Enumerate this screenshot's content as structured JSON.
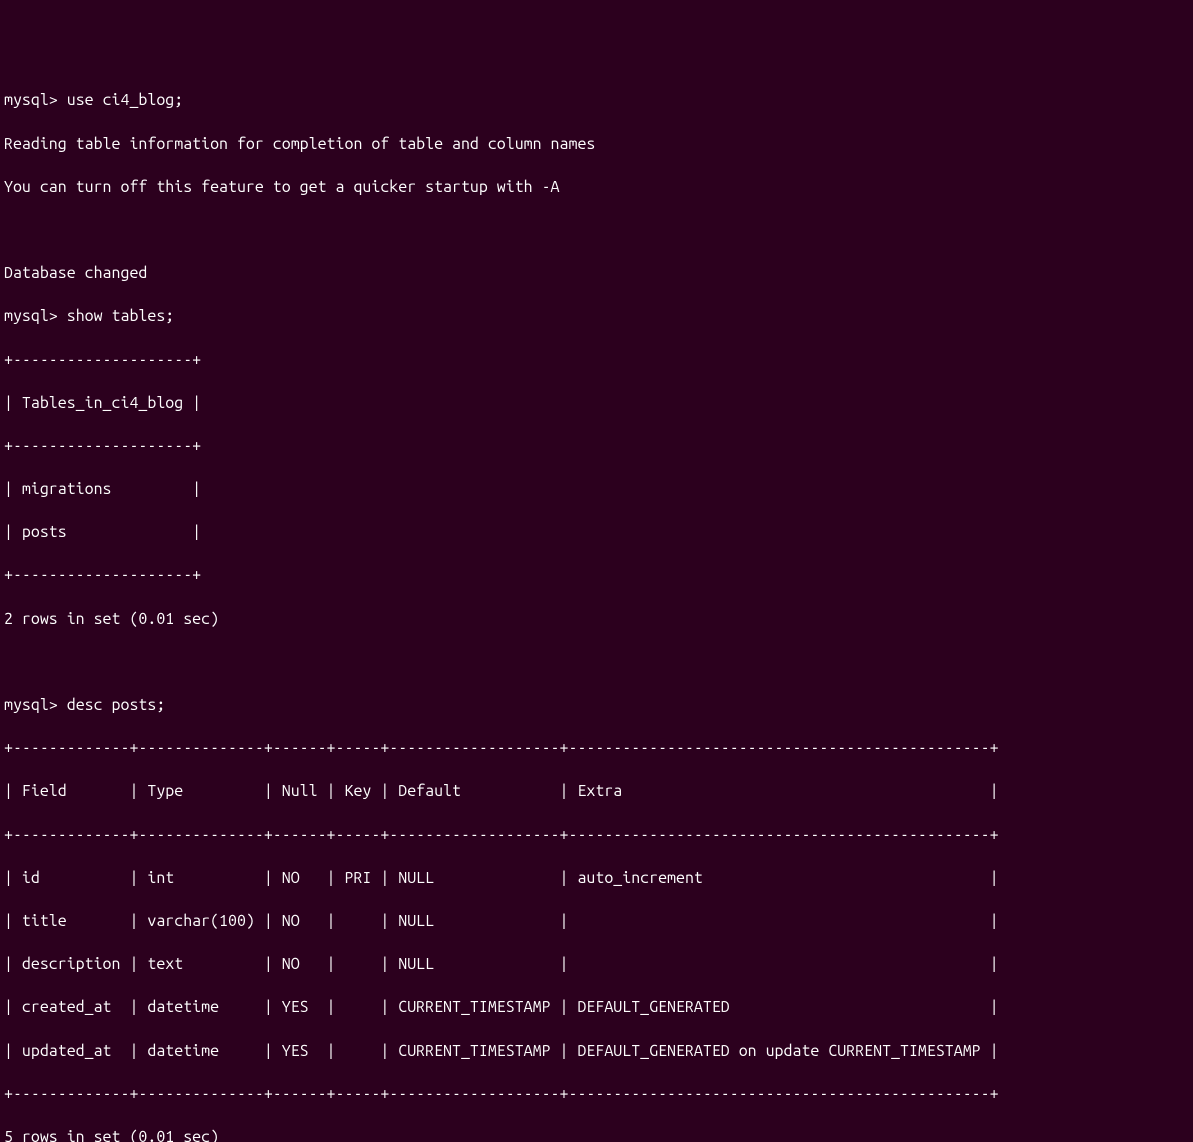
{
  "prompt": "mysql>",
  "cmd1": "use ci4_blog;",
  "msg1": "Reading table information for completion of table and column names",
  "msg2": "You can turn off this feature to get a quicker startup with -A",
  "msg3": "Database changed",
  "cmd2": "show tables;",
  "tables_border": "+--------------------+",
  "tables_header": "| Tables_in_ci4_blog |",
  "tables_row1": "| migrations         |",
  "tables_row2": "| posts              |",
  "tables_result": "2 rows in set (0.01 sec)",
  "cmd3": "desc posts;",
  "desc_border": "+-------------+--------------+------+-----+-------------------+-----------------------------------------------+",
  "desc_header": "| Field       | Type         | Null | Key | Default           | Extra                                         |",
  "desc_row1": "| id          | int          | NO   | PRI | NULL              | auto_increment                                |",
  "desc_row2": "| title       | varchar(100) | NO   |     | NULL              |                                               |",
  "desc_row3": "| description | text         | NO   |     | NULL              |                                               |",
  "desc_row4": "| created_at  | datetime     | YES  |     | CURRENT_TIMESTAMP | DEFAULT_GENERATED                             |",
  "desc_row5": "| updated_at  | datetime     | YES  |     | CURRENT_TIMESTAMP | DEFAULT_GENERATED on update CURRENT_TIMESTAMP |",
  "desc_result": "5 rows in set (0.01 sec)"
}
